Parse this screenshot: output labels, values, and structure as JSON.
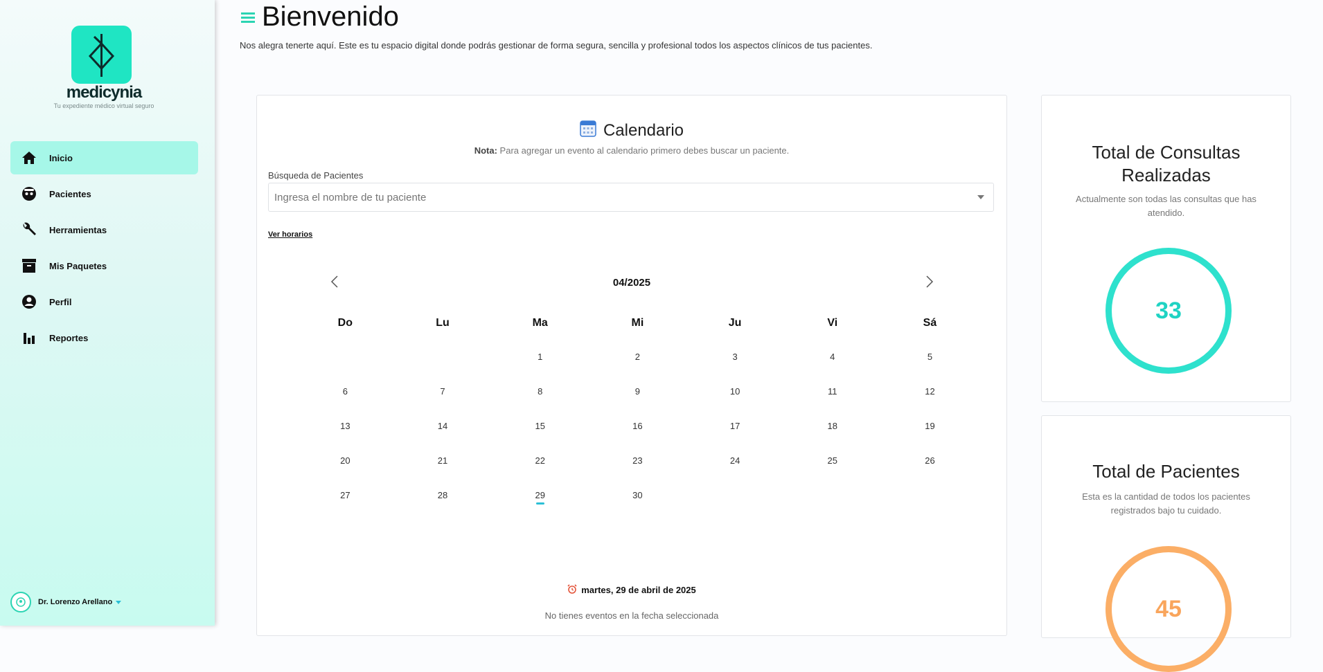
{
  "brand": {
    "name": "medicynia",
    "tagline": "Tu expediente médico virtual seguro"
  },
  "nav": {
    "items": [
      {
        "label": "Inicio",
        "icon": "home-icon",
        "active": true
      },
      {
        "label": "Pacientes",
        "icon": "patient-icon"
      },
      {
        "label": "Herramientas",
        "icon": "wrench-icon"
      },
      {
        "label": "Mis Paquetes",
        "icon": "archive-icon"
      },
      {
        "label": "Perfil",
        "icon": "profile-icon"
      },
      {
        "label": "Reportes",
        "icon": "bar-chart-icon"
      }
    ]
  },
  "user": {
    "name": "Dr. Lorenzo Arellano"
  },
  "header": {
    "title": "Bienvenido",
    "subtitle": "Nos alegra tenerte aquí. Este es tu espacio digital donde podrás gestionar de forma segura, sencilla y profesional todos los aspectos clínicos de tus pacientes."
  },
  "calendar": {
    "title": "Calendario",
    "note_label": "Nota:",
    "note_text": " Para agregar un evento al calendario primero debes buscar un paciente.",
    "search_label": "Búsqueda de Pacientes",
    "search_placeholder": "Ingresa el nombre de tu paciente",
    "schedule_link": "Ver horarios",
    "month": "04/2025",
    "weekdays": [
      "Do",
      "Lu",
      "Ma",
      "Mi",
      "Ju",
      "Vi",
      "Sá"
    ],
    "weeks": [
      [
        "",
        "",
        "1",
        "2",
        "3",
        "4",
        "5"
      ],
      [
        "6",
        "7",
        "8",
        "9",
        "10",
        "11",
        "12"
      ],
      [
        "13",
        "14",
        "15",
        "16",
        "17",
        "18",
        "19"
      ],
      [
        "20",
        "21",
        "22",
        "23",
        "24",
        "25",
        "26"
      ],
      [
        "27",
        "28",
        "29",
        "30",
        "",
        "",
        ""
      ]
    ],
    "marked_day": "29",
    "selected_date": "martes, 29 de abril de 2025",
    "no_events": "No tienes eventos en la fecha seleccionada"
  },
  "stats": {
    "consultations": {
      "title_line1": "Total de Consultas",
      "title_line2": "Realizadas",
      "description": "Actualmente son todas las consultas que has atendido.",
      "value": "33",
      "color": "#2ee1cd"
    },
    "patients": {
      "title": "Total de Pacientes",
      "description": "Esta es la cantidad de todos los pacientes registrados bajo tu cuidado.",
      "value": "45",
      "color": "#fbae66"
    }
  }
}
